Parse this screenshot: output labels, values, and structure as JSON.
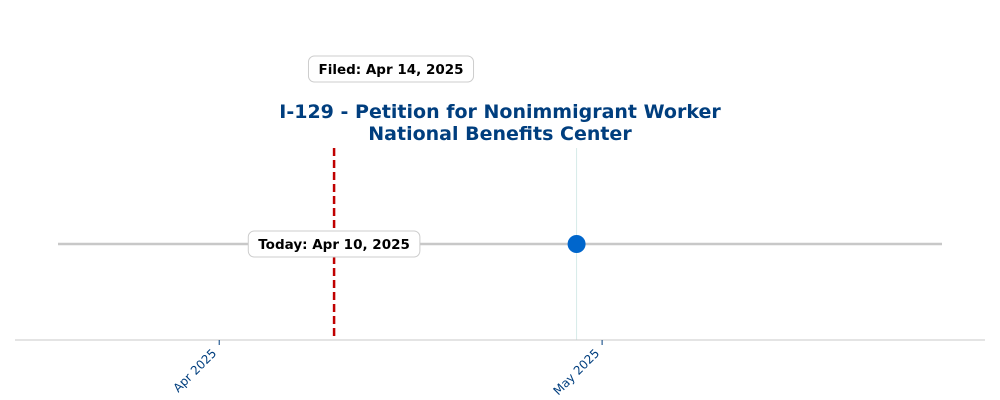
{
  "chart_data": {
    "type": "scatter",
    "title": "I-129 - Petition for Nonimmigrant Worker",
    "subtitle": "National Benefits Center",
    "xlabel": "",
    "ylabel": "",
    "x_range": [
      "2025-03-16",
      "2025-05-31"
    ],
    "x_ticks": [
      {
        "date": "2025-04-01",
        "label": "Apr 2025"
      },
      {
        "date": "2025-05-01",
        "label": "May 2025"
      }
    ],
    "grid": false,
    "legend": "none",
    "series": [
      {
        "points": [
          {
            "x": "2025-04-14",
            "style": "pale"
          },
          {
            "x": "2025-04-29",
            "style": "solid"
          }
        ]
      }
    ],
    "markers": [
      {
        "x": "2025-04-14",
        "label": "Filed: Apr 14, 2025"
      },
      {
        "x": "2025-04-10",
        "label": "Today: Apr 10, 2025"
      }
    ],
    "colors": {
      "title": "#003e7e",
      "tick_label": "#003e7e",
      "timeline": "#c8c8c8",
      "today_line": "#c00000",
      "point_solid": "#0066cc",
      "point_pale": "#dce6f2",
      "vertical_guide": "#d6ebe8",
      "axis": "#c8c8c8",
      "callout_border": "#cccccc"
    }
  }
}
